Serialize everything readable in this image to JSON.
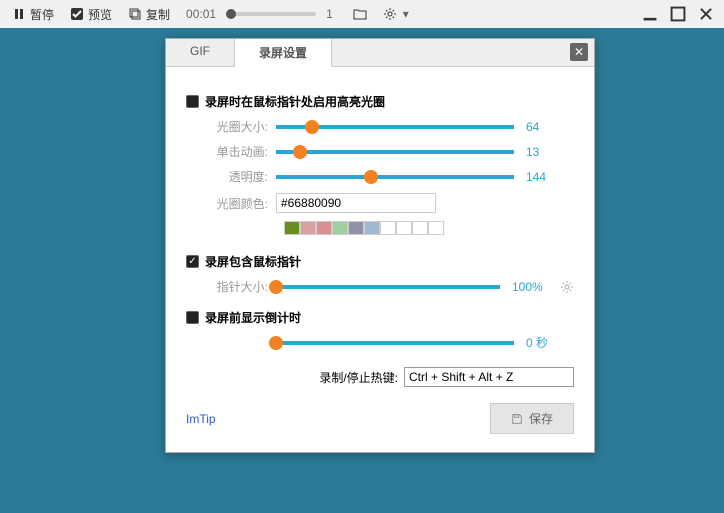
{
  "toolbar": {
    "pause": "暂停",
    "preview": "预览",
    "copy": "复制",
    "time": "00:01",
    "frame": "1"
  },
  "dialog": {
    "tabs": {
      "gif": "GIF",
      "settings": "录屏设置"
    },
    "section1": {
      "title": "录屏时在鼠标指针处启用高亮光圈",
      "size_label": "光圈大小:",
      "size_val": "64",
      "click_label": "单击动画:",
      "click_val": "13",
      "opacity_label": "透明度:",
      "opacity_val": "144",
      "color_label": "光圈颜色:",
      "color_val": "#66880090"
    },
    "section2": {
      "title": "录屏包含鼠标指针",
      "ptr_label": "指针大小:",
      "ptr_val": "100%"
    },
    "section3": {
      "title": "录屏前显示倒计时",
      "count_val": "0 秒"
    },
    "hotkey": {
      "label": "录制/停止热键:",
      "value": "Ctrl + Shift + Alt + Z"
    },
    "footer": {
      "link": "ImTip",
      "save": "保存"
    }
  },
  "swatches": [
    "#6b8e23",
    "#d9a0a0",
    "#d99090",
    "#a0d0a0",
    "#9090a8",
    "#a0b8d0",
    "#ffffff",
    "#ffffff",
    "#ffffff",
    "#ffffff"
  ],
  "sliders": {
    "size": 15,
    "click": 10,
    "opacity": 40,
    "ptr": 0,
    "count": 0
  }
}
